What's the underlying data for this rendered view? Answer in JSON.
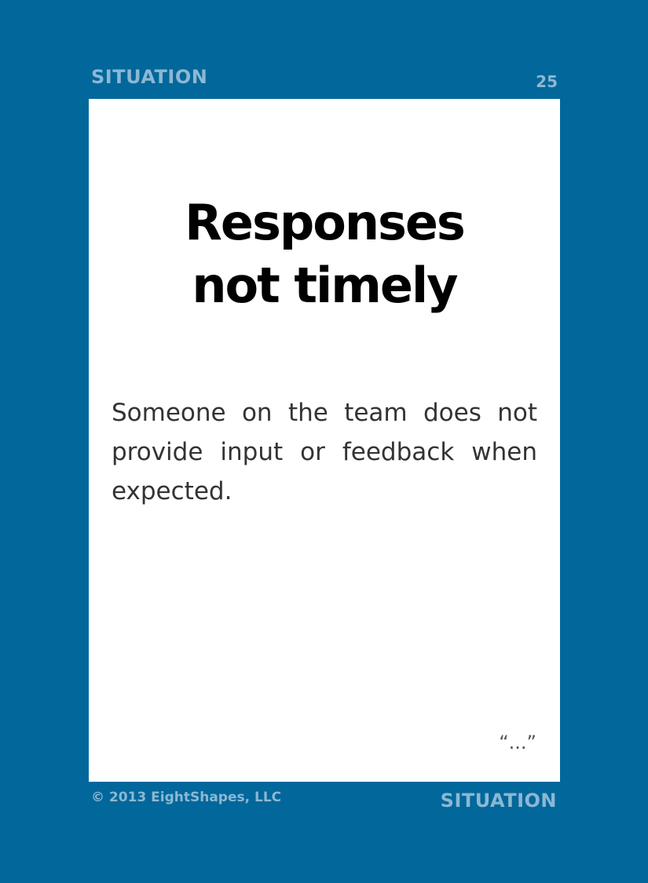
{
  "header": {
    "category_label": "SITUATION",
    "card_number": "25"
  },
  "card": {
    "title_lines": [
      "Responses",
      "not timely"
    ],
    "description": "Someone on the team does not provide input or feedback when expected.",
    "quote_mark": "“...”"
  },
  "footer": {
    "copyright": "© 2013 EightShapes, LLC",
    "category_label": "SITUATION"
  },
  "colors": {
    "background": "#02679a",
    "label": "#8bb8d4",
    "card": "#ffffff",
    "title": "#000000",
    "body_text": "#333333"
  }
}
